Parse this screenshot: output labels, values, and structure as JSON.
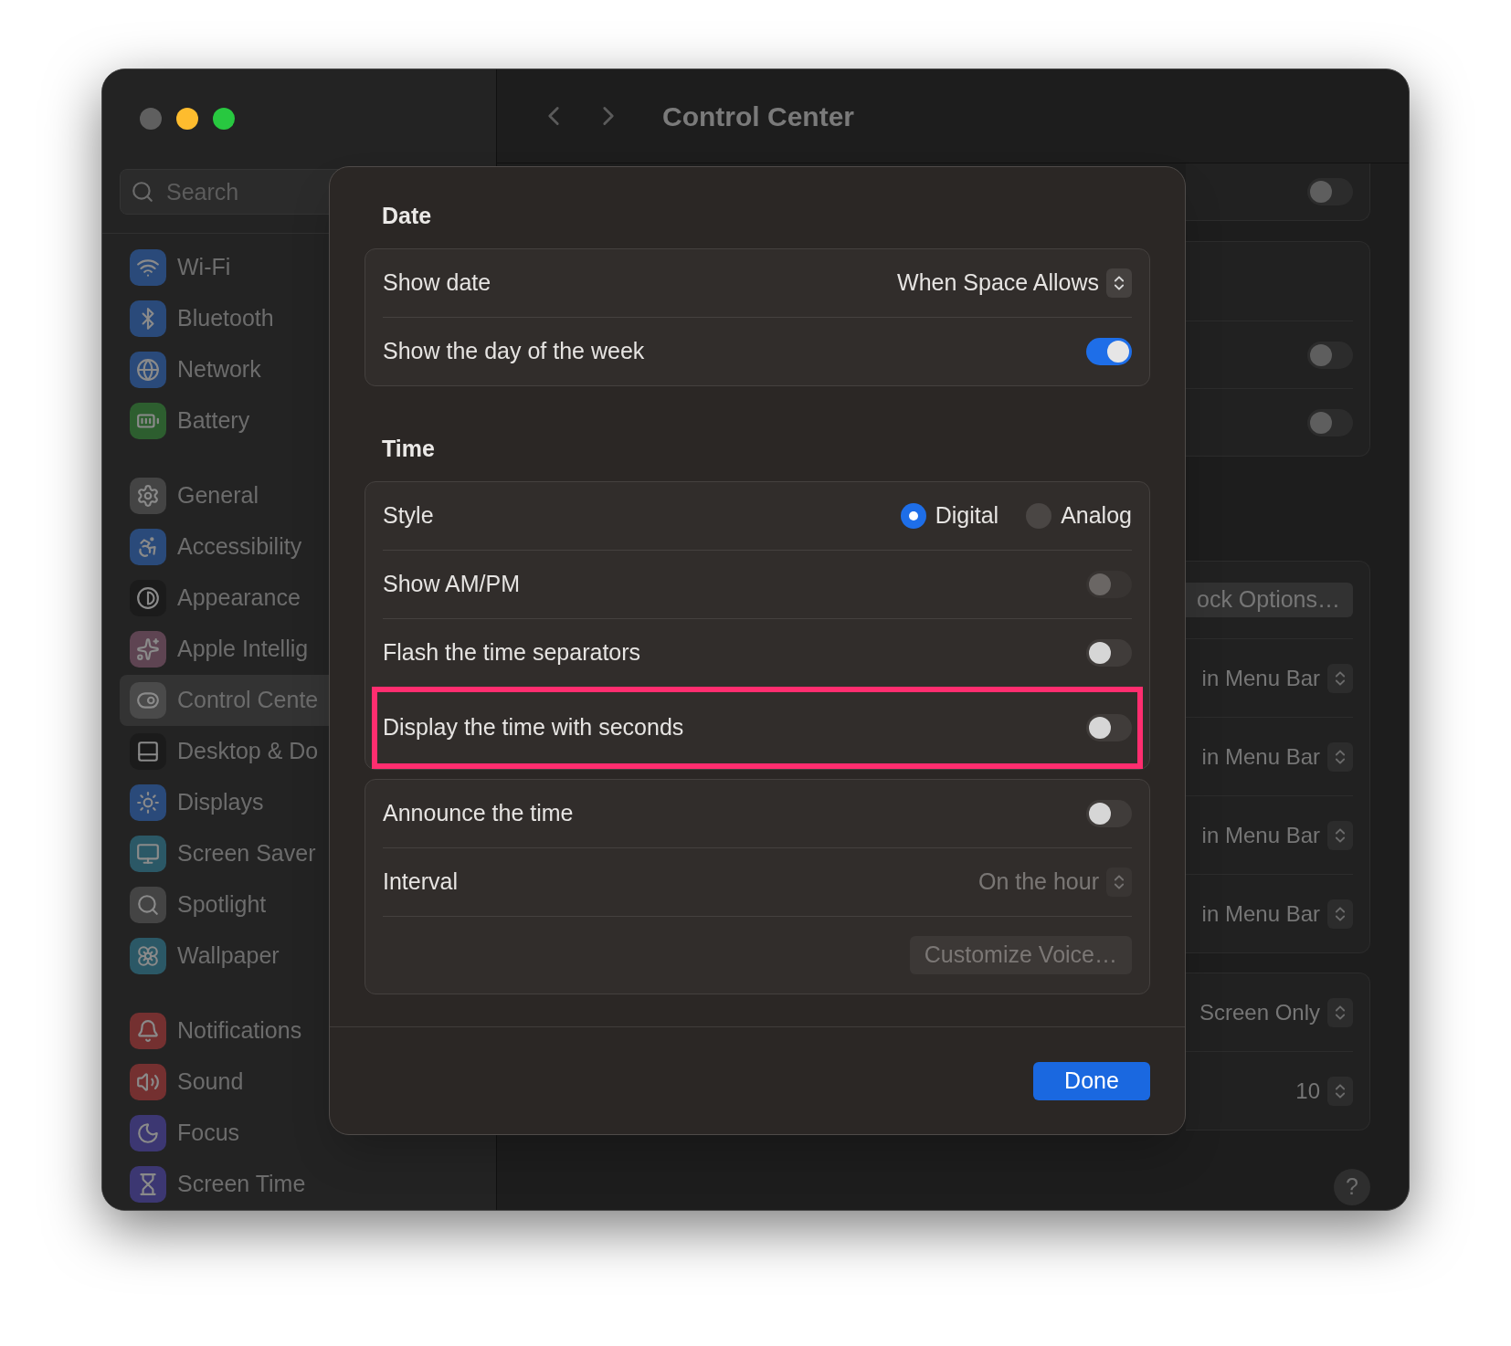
{
  "window": {
    "title": "Control Center",
    "traffic_lights": [
      {
        "color": "#5f5f5f"
      },
      {
        "color": "#febc2e"
      },
      {
        "color": "#28c840"
      }
    ]
  },
  "sidebar": {
    "search": {
      "placeholder": "Search"
    },
    "groups": [
      {
        "items": [
          {
            "label": "Wi-Fi",
            "color": "#2a4a7a",
            "selected": false
          },
          {
            "label": "Bluetooth",
            "color": "#2a4a7a",
            "selected": false
          },
          {
            "label": "Network",
            "color": "#2a4a7a",
            "selected": false
          },
          {
            "label": "Battery",
            "color": "#2d5e2f",
            "selected": false
          }
        ]
      },
      {
        "items": [
          {
            "label": "General",
            "color": "#444444",
            "selected": false
          },
          {
            "label": "Accessibility",
            "color": "#2a4a7a",
            "selected": false
          },
          {
            "label": "Appearance",
            "color": "#1b1b1b",
            "selected": false
          },
          {
            "label": "Apple Intellig",
            "color": "#5e4452",
            "selected": false
          },
          {
            "label": "Control Cente",
            "color": "#4a4a4a",
            "selected": true
          },
          {
            "label": "Desktop & Do",
            "color": "#1b1b1b",
            "selected": false
          },
          {
            "label": "Displays",
            "color": "#2a4a7a",
            "selected": false
          },
          {
            "label": "Screen Saver",
            "color": "#2b5866",
            "selected": false
          },
          {
            "label": "Spotlight",
            "color": "#444444",
            "selected": false
          },
          {
            "label": "Wallpaper",
            "color": "#2b5866",
            "selected": false
          }
        ]
      },
      {
        "items": [
          {
            "label": "Notifications",
            "color": "#743030",
            "selected": false
          },
          {
            "label": "Sound",
            "color": "#743030",
            "selected": false
          },
          {
            "label": "Focus",
            "color": "#3c3772",
            "selected": false
          },
          {
            "label": "Screen Time",
            "color": "#3c3772",
            "selected": false
          }
        ]
      }
    ]
  },
  "background_cards": [
    {
      "rows": [
        {
          "kind": "toggle",
          "on": false
        }
      ]
    },
    {
      "rows": [
        {
          "kind": "blank"
        },
        {
          "kind": "toggle",
          "on": false
        },
        {
          "kind": "toggle",
          "on": false
        }
      ]
    },
    {
      "rows": [
        {
          "kind": "button",
          "label": "ock Options…"
        },
        {
          "kind": "popup",
          "value": "in Menu Bar"
        },
        {
          "kind": "popup",
          "value": "in Menu Bar"
        },
        {
          "kind": "popup",
          "value": "in Menu Bar"
        },
        {
          "kind": "popup",
          "value": "in Menu Bar"
        }
      ]
    },
    {
      "rows": [
        {
          "kind": "popup",
          "value": "Screen Only"
        },
        {
          "kind": "popup",
          "value": "10"
        }
      ]
    }
  ],
  "help_button": "?",
  "sheet": {
    "sections": [
      {
        "title": "Date",
        "groups": [
          {
            "rows": [
              {
                "kind": "popup",
                "label": "Show date",
                "value": "When Space Allows",
                "disabled": false,
                "highlighted": false
              },
              {
                "kind": "toggle",
                "label": "Show the day of the week",
                "on": true,
                "disabled": false,
                "highlighted": false
              }
            ]
          }
        ]
      },
      {
        "title": "Time",
        "groups": [
          {
            "rows": [
              {
                "kind": "radio",
                "label": "Style",
                "options": [
                  {
                    "label": "Digital",
                    "selected": true
                  },
                  {
                    "label": "Analog",
                    "selected": false
                  }
                ],
                "highlighted": false
              },
              {
                "kind": "toggle",
                "label": "Show AM/PM",
                "on": false,
                "disabled": true,
                "highlighted": false
              },
              {
                "kind": "toggle",
                "label": "Flash the time separators",
                "on": false,
                "disabled": false,
                "highlighted": false
              },
              {
                "kind": "toggle",
                "label": "Display the time with seconds",
                "on": false,
                "disabled": false,
                "highlighted": true
              }
            ]
          },
          {
            "rows": [
              {
                "kind": "toggle",
                "label": "Announce the time",
                "on": false,
                "disabled": false,
                "highlighted": false
              },
              {
                "kind": "popup",
                "label": "Interval",
                "value": "On the hour",
                "disabled": true,
                "highlighted": false
              },
              {
                "kind": "button",
                "label": "Customize Voice…",
                "disabled": true,
                "highlighted": false
              }
            ]
          }
        ]
      }
    ],
    "done_button": "Done"
  }
}
